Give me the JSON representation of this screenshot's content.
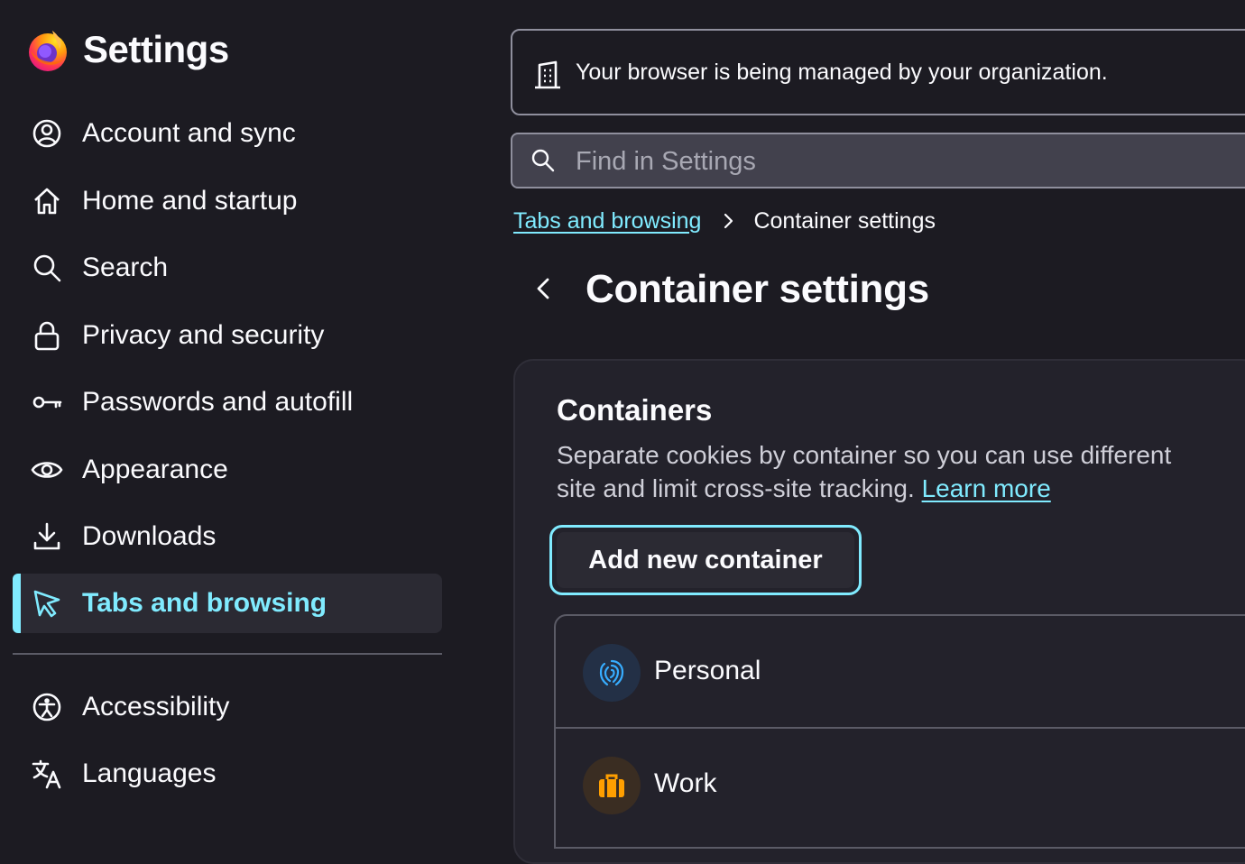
{
  "sidebar": {
    "brand_title": "Settings",
    "items": [
      {
        "label": "Account and sync",
        "icon": "account-icon"
      },
      {
        "label": "Home and startup",
        "icon": "home-icon"
      },
      {
        "label": "Search",
        "icon": "search-icon"
      },
      {
        "label": "Privacy and security",
        "icon": "lock-icon"
      },
      {
        "label": "Passwords and autofill",
        "icon": "key-icon"
      },
      {
        "label": "Appearance",
        "icon": "eye-icon"
      },
      {
        "label": "Downloads",
        "icon": "download-icon"
      },
      {
        "label": "Tabs and browsing",
        "icon": "cursor-icon",
        "active": true
      },
      {
        "label": "Accessibility",
        "icon": "accessibility-icon"
      },
      {
        "label": "Languages",
        "icon": "translate-icon"
      }
    ]
  },
  "notice": {
    "text": "Your browser is being managed by your organization."
  },
  "search": {
    "placeholder": "Find in Settings"
  },
  "breadcrumb": {
    "parent": "Tabs and browsing",
    "current": "Container settings"
  },
  "page": {
    "title": "Container settings"
  },
  "containers": {
    "heading": "Containers",
    "description": "Separate cookies by container so you can use different",
    "description_line2": "site and limit cross-site tracking.",
    "learn_more": "Learn more",
    "add_button": "Add new container",
    "items": [
      {
        "name": "Personal",
        "icon": "fingerprint-icon",
        "color": "#37adff"
      },
      {
        "name": "Work",
        "icon": "briefcase-icon",
        "color": "#ff9f00"
      }
    ]
  },
  "colors": {
    "accent": "#80ebff",
    "background": "#1c1b22"
  }
}
